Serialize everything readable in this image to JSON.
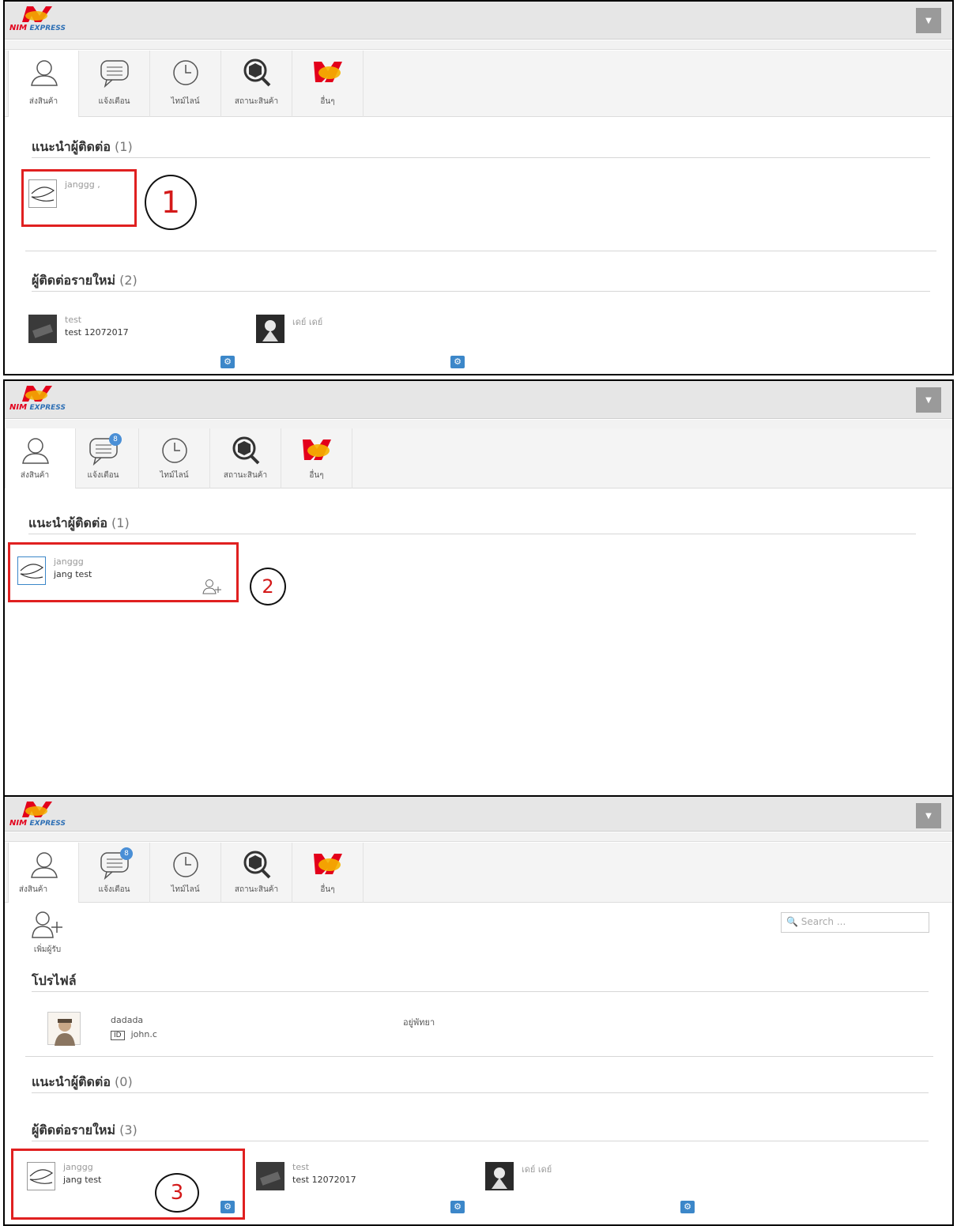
{
  "app": {
    "logo_main": "NIM",
    "logo_sub": "EXPRESS",
    "menu_icon": "dropdown-caret"
  },
  "tabs": [
    {
      "label": "ส่งสินค้า",
      "icon": "user-icon"
    },
    {
      "label": "แจ้งเตือน",
      "icon": "chat-icon"
    },
    {
      "label": "ไทม์ไลน์",
      "icon": "clock-icon"
    },
    {
      "label": "สถานะสินค้า",
      "icon": "package-search-icon"
    },
    {
      "label": "อื่นๆ",
      "icon": "nim-logo-icon"
    }
  ],
  "notif_badge": "8",
  "panel1": {
    "suggest_title": "แนะนำผู้ติดต่อ",
    "suggest_count": "(1)",
    "suggest_contact": {
      "name": "janggg ,"
    },
    "callout": "1",
    "new_title": "ผู้ติดต่อรายใหม่",
    "new_count": "(2)",
    "new_contacts": [
      {
        "name": "test",
        "sub": "test 12072017"
      },
      {
        "name": "เดย์ เดย์",
        "sub": ""
      }
    ]
  },
  "panel2": {
    "suggest_title": "แนะนำผู้ติดต่อ",
    "suggest_count": "(1)",
    "suggest_contact": {
      "name": "janggg",
      "sub": "jang test"
    },
    "callout": "2"
  },
  "panel3": {
    "add_receiver_label": "เพิ่มผู้รับ",
    "search_placeholder": "Search ...",
    "profile_title": "โปรไฟล์",
    "profile": {
      "name": "dadada",
      "id_label": "ID",
      "id_value": "john.c",
      "location": "อยู่พัทยา"
    },
    "suggest_title": "แนะนำผู้ติดต่อ",
    "suggest_count": "(0)",
    "new_title": "ผู้ติดต่อรายใหม่",
    "new_count": "(3)",
    "new_contacts": [
      {
        "name": "janggg",
        "sub": "jang test"
      },
      {
        "name": "test",
        "sub": "test 12072017"
      },
      {
        "name": "เดย์ เดย์",
        "sub": ""
      }
    ],
    "callout": "3"
  },
  "colors": {
    "accent": "#3c87c9",
    "highlight": "#e02020",
    "brand_red": "#e3001b",
    "brand_yellow": "#f5b400"
  }
}
